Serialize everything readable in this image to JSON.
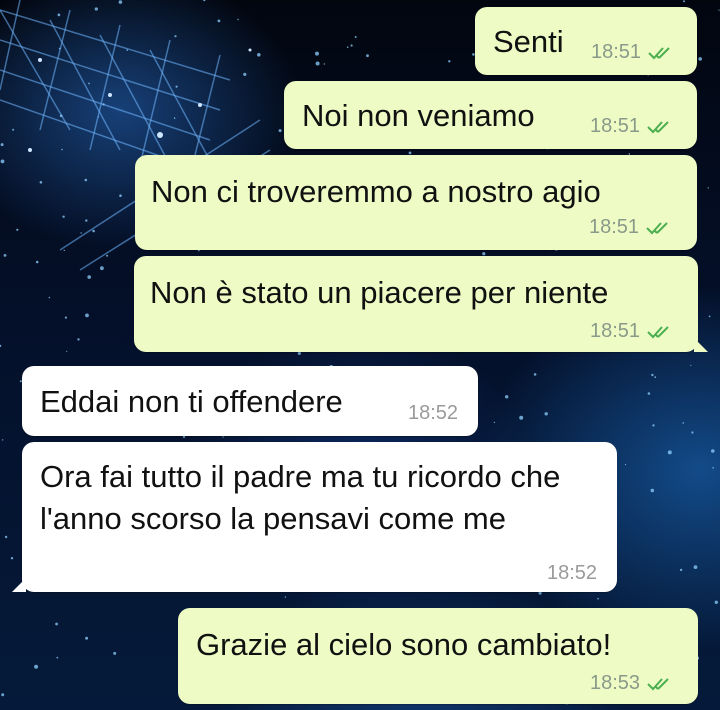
{
  "chat": {
    "wallpaper_icon": "space-network-wallpaper",
    "colors": {
      "outgoing_bubble": "#eefbc4",
      "incoming_bubble": "#ffffff",
      "read_ticks": "#4caf50",
      "timestamp": "#8a9a8a"
    },
    "messages": [
      {
        "direction": "outgoing",
        "text": "Senti",
        "time": "18:51",
        "status_icon": "double-check-read-icon"
      },
      {
        "direction": "outgoing",
        "text": "Noi non veniamo",
        "time": "18:51",
        "status_icon": "double-check-read-icon"
      },
      {
        "direction": "outgoing",
        "text": "Non ci troveremmo a nostro agio",
        "time": "18:51",
        "status_icon": "double-check-read-icon"
      },
      {
        "direction": "outgoing",
        "text": "Non è stato un piacere per niente",
        "time": "18:51",
        "status_icon": "double-check-read-icon"
      },
      {
        "direction": "incoming",
        "text": "Eddai non ti offendere",
        "time": "18:52"
      },
      {
        "direction": "incoming",
        "text": "Ora fai tutto il padre ma tu ricordo che l'anno scorso la pensavi come me",
        "time": "18:52"
      },
      {
        "direction": "outgoing",
        "text": "Grazie al cielo sono cambiato!",
        "time": "18:53",
        "status_icon": "double-check-read-icon"
      }
    ]
  }
}
